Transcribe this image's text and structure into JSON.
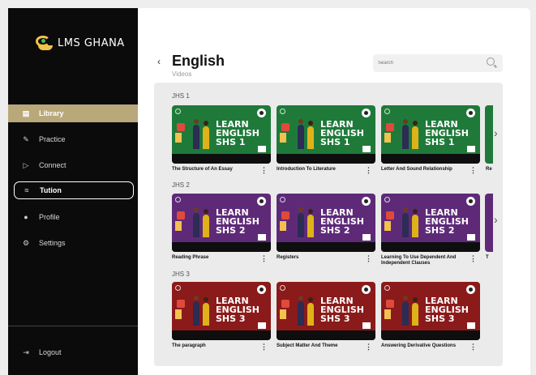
{
  "app": {
    "logo_text": "LMS GHANA"
  },
  "sidebar": {
    "items": [
      {
        "label": "Library",
        "icon": "book-icon"
      },
      {
        "label": "Practice",
        "icon": "pencil-icon"
      },
      {
        "label": "Connect",
        "icon": "play-icon"
      },
      {
        "label": "Tution",
        "icon": "wifi-icon"
      },
      {
        "label": "Profile",
        "icon": "person-icon"
      },
      {
        "label": "Settings",
        "icon": "gear-icon"
      }
    ],
    "logout": {
      "label": "Logout",
      "icon": "logout-icon"
    }
  },
  "header": {
    "back_icon": "chevron-left-icon",
    "title": "English",
    "subtitle": "Videos",
    "search_placeholder": "Search"
  },
  "sections": [
    {
      "label": "JHS 1",
      "thumb_lines": [
        "LEARN",
        "ENGLISH",
        "SHS 1"
      ],
      "color": "#1f7a3a",
      "cards": [
        "The Structure of An Essay",
        "Introduction To Literature",
        "Letter And Sound Relationship"
      ],
      "peek_title": "Re"
    },
    {
      "label": "JHS 2",
      "thumb_lines": [
        "LEARN",
        "ENGLISH",
        "SHS 2"
      ],
      "color": "#5e2a78",
      "cards": [
        "Reading Phrase",
        "Registers",
        "Learning To Use Dependent And Independent Clauses"
      ],
      "peek_title": "T"
    },
    {
      "label": "JHS 3",
      "thumb_lines": [
        "LEARN",
        "ENGLISH",
        "SHS 3"
      ],
      "color": "#8b1a1a",
      "cards": [
        "The paragraph",
        "Subject Matter And Theme",
        "Answering Derivative Questions"
      ],
      "peek_title": ""
    }
  ]
}
